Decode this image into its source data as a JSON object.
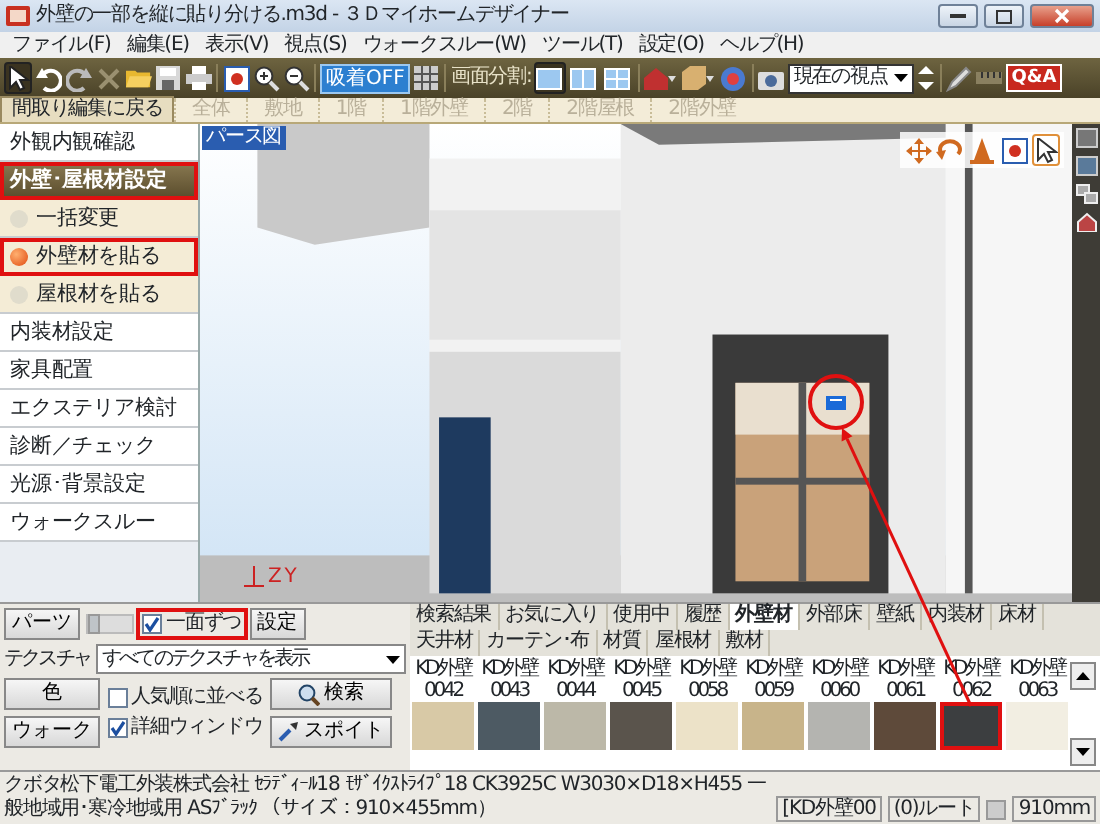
{
  "window": {
    "title": "外壁の一部を縦に貼り分ける.m3d - ３Ｄマイホームデザイナー"
  },
  "menu": [
    "ファイル(F)",
    "編集(E)",
    "表示(V)",
    "視点(S)",
    "ウォークスルー(W)",
    "ツール(T)",
    "設定(O)",
    "ヘルプ(H)"
  ],
  "toolbar": {
    "snap_button": "吸着OFF",
    "split_label": "画面分割:",
    "split_views": [
      {
        "selected": true
      },
      {
        "selected": false
      },
      {
        "selected": false
      }
    ],
    "viewpoint": "現在の視点",
    "qa_button": "Q&A"
  },
  "back_tab": "間取り編集に戻る",
  "floor_tabs": [
    {
      "label": "全体",
      "disabled": true
    },
    {
      "label": "敷地",
      "disabled": true
    },
    {
      "label": "1階",
      "disabled": true
    },
    {
      "label": "1階外壁",
      "disabled": true
    },
    {
      "label": "2階",
      "disabled": true
    },
    {
      "label": "2階屋根",
      "disabled": true
    },
    {
      "label": "2階外壁",
      "disabled": true
    }
  ],
  "sidebar": {
    "items": [
      {
        "label": "外観内観確認",
        "kind": "item",
        "selected": false,
        "highlighted": false
      },
      {
        "label": "外壁･屋根材設定",
        "kind": "item",
        "selected": true,
        "highlighted": true
      },
      {
        "label": "一括変更",
        "kind": "sub",
        "selected": false,
        "highlighted": false
      },
      {
        "label": "外壁材を貼る",
        "kind": "sub",
        "selected": true,
        "highlighted": true
      },
      {
        "label": "屋根材を貼る",
        "kind": "sub",
        "selected": false,
        "highlighted": false
      },
      {
        "label": "内装材設定",
        "kind": "item",
        "selected": false,
        "highlighted": false
      },
      {
        "label": "家具配置",
        "kind": "item",
        "selected": false,
        "highlighted": false
      },
      {
        "label": "エクステリア検討",
        "kind": "item",
        "selected": false,
        "highlighted": false
      },
      {
        "label": "診断／チェック",
        "kind": "item",
        "selected": false,
        "highlighted": false
      },
      {
        "label": "光源･背景設定",
        "kind": "item",
        "selected": false,
        "highlighted": false
      },
      {
        "label": "ウォークスルー",
        "kind": "item",
        "selected": false,
        "highlighted": false
      }
    ]
  },
  "viewport": {
    "label": "パース図",
    "axes": [
      "Z",
      "Y"
    ]
  },
  "parts_panel": {
    "parts_button": "パーツ",
    "size_slider": {
      "level": 0
    },
    "one_face": {
      "label": "一面ずつ",
      "checked": true,
      "highlighted": true
    },
    "settings_button": "設定",
    "texture_label": "テクスチャ",
    "texture_filter": "すべてのテクスチャを表示",
    "color_button": "色",
    "walk_button": "ウォーク",
    "options": [
      {
        "label": "人気順に並べる",
        "checked": false
      },
      {
        "label": "詳細ウィンドウ",
        "checked": true
      }
    ],
    "search_button": "検索",
    "eyedropper_button": "スポイト"
  },
  "material_tabs": [
    {
      "label": "検索結果",
      "selected": false
    },
    {
      "label": "お気に入り",
      "selected": false
    },
    {
      "label": "使用中",
      "selected": false
    },
    {
      "label": "履歴",
      "selected": false
    },
    {
      "label": "外壁材",
      "selected": true
    },
    {
      "label": "外部床",
      "selected": false
    },
    {
      "label": "壁紙",
      "selected": false
    },
    {
      "label": "内装材",
      "selected": false
    },
    {
      "label": "床材",
      "selected": false
    },
    {
      "label": "天井材",
      "selected": false
    },
    {
      "label": "カーテン･布",
      "selected": false
    },
    {
      "label": "材質",
      "selected": false
    },
    {
      "label": "屋根材",
      "selected": false
    },
    {
      "label": "敷材",
      "selected": false
    }
  ],
  "swatches": [
    {
      "label": "KD外壁0042",
      "color": "#d8c9a6",
      "selected": false
    },
    {
      "label": "KD外壁0043",
      "color": "#4d5a63",
      "selected": false
    },
    {
      "label": "KD外壁0044",
      "color": "#bcb8a8",
      "selected": false
    },
    {
      "label": "KD外壁0045",
      "color": "#5a544c",
      "selected": false
    },
    {
      "label": "KD外壁0058",
      "color": "#ece2c8",
      "selected": false
    },
    {
      "label": "KD外壁0059",
      "color": "#c8b48a",
      "selected": false
    },
    {
      "label": "KD外壁0060",
      "color": "#b4b4b0",
      "selected": false
    },
    {
      "label": "KD外壁0061",
      "color": "#5e4a3a",
      "selected": false
    },
    {
      "label": "KD外壁0062",
      "color": "#3c3e40",
      "selected": true
    },
    {
      "label": "KD外壁0063",
      "color": "#f2eee2",
      "selected": false
    }
  ],
  "status_bar": {
    "description": "クボタ松下電工外装株式会社 ｾﾗﾃﾞｨｰﾙ18 ﾓｻﾞｲｸｽﾄﾗｲﾌﾟ18 CK3925C W3030×D18×H455 一般地域用･寒冷地域用 ASﾌﾞﾗｯｸ （サイズ：910×455mm）",
    "code": "[KD外壁00",
    "route": "(0)ルート",
    "length": "910mm"
  }
}
